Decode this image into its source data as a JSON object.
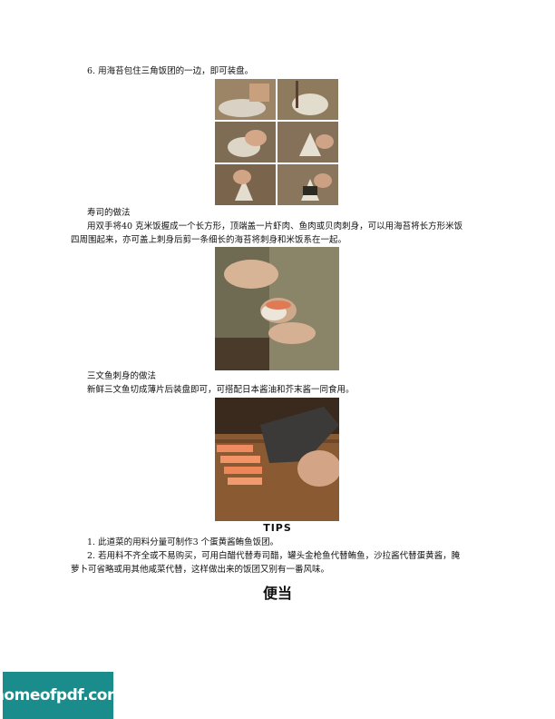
{
  "step6": "6. 用海苔包住三角饭团的一边，即可装盘。",
  "sushi": {
    "heading": "寿司的做法",
    "line1": "用双手将40 克米饭握成一个长方形，顶端盖一片虾肉、鱼肉或贝肉刺身，可以用海苔将长方形米饭",
    "line2": "四周围起来，亦可盖上刺身后剪一条细长的海苔将刺身和米饭系在一起。"
  },
  "salmon": {
    "heading": "三文鱼刺身的做法",
    "line1": "新鲜三文鱼切成薄片后装盘即可，可搭配日本酱油和芥末酱一同食用。"
  },
  "tips": {
    "title": "TIPS",
    "item1": "1. 此道菜的用料分量可制作3 个蛋黄酱鲔鱼饭团。",
    "item2_line1": "2. 若用料不齐全或不易购买，可用白醋代替寿司醋，罐头金枪鱼代替鲔鱼，沙拉酱代替蛋黄酱，腌",
    "item2_line2": "萝卜可省略或用其他咸菜代替，这样做出来的饭团又别有一番风味。"
  },
  "section_title": "便当",
  "watermark": "homeofpdf.com"
}
